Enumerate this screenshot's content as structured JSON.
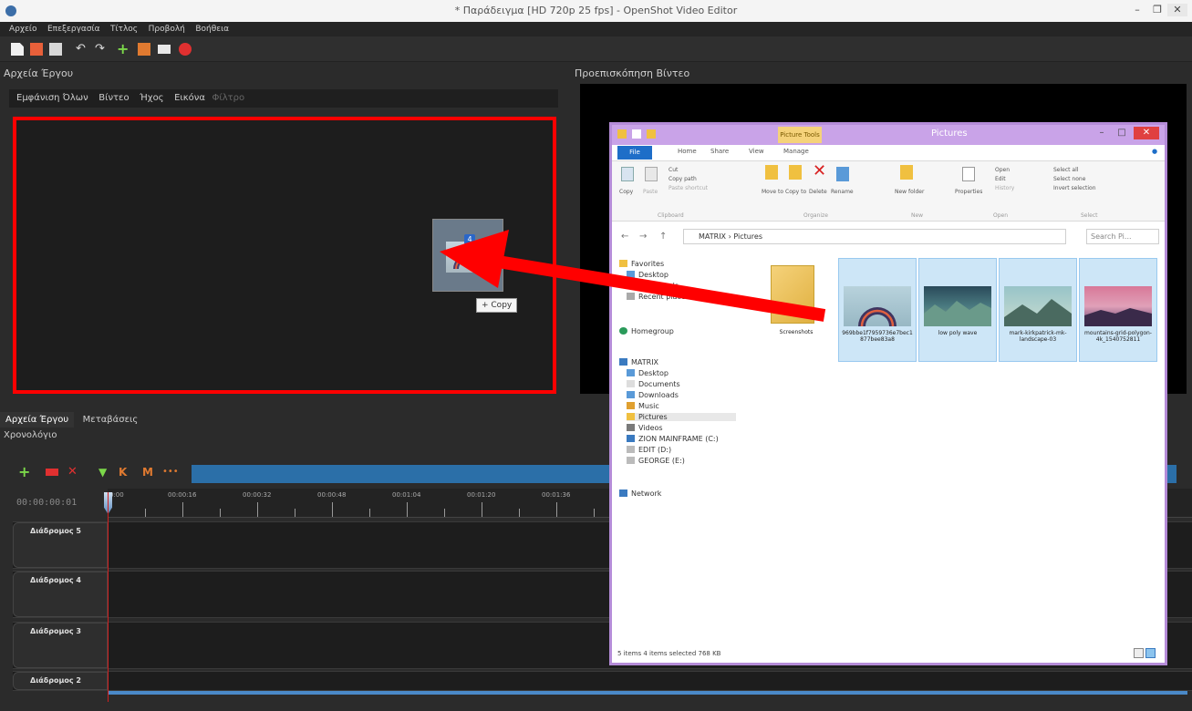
{
  "window": {
    "title": "* Παράδειγμα [HD 720p 25 fps] - OpenShot Video Editor",
    "controls": {
      "minimize": "–",
      "restore": "❐",
      "close": "✕"
    }
  },
  "menu": [
    "Αρχείο",
    "Επεξεργασία",
    "Τίτλος",
    "Προβολή",
    "Βοήθεια"
  ],
  "toolbar_icons": [
    "new-project-icon",
    "open-project-icon",
    "save-project-icon",
    "undo-icon",
    "redo-icon",
    "import-files-icon",
    "profile-icon",
    "fullscreen-icon",
    "export-video-icon"
  ],
  "files_panel": {
    "title": "Αρχεία Έργου",
    "filters": [
      "Εμφάνιση Όλων",
      "Βίντεο",
      "Ήχος",
      "Εικόνα"
    ],
    "filter_placeholder": "Φίλτρο",
    "drag_label": "+ Copy"
  },
  "preview_panel": {
    "title": "Προεπισκόπηση Βίντεο"
  },
  "bottom_tabs": [
    "Αρχεία Έργου",
    "Μεταβάσεις"
  ],
  "timeline": {
    "label": "Χρονολόγιο",
    "time_readout": "00:00:00:01",
    "ticks": [
      "0:00",
      "00:00:16",
      "00:00:32",
      "00:00:48",
      "00:01:04",
      "00:01:20",
      "00:01:36"
    ],
    "tracks": [
      "Διάδρομος 5",
      "Διάδρομος 4",
      "Διάδρομος 3",
      "Διάδρομος 2"
    ]
  },
  "explorer": {
    "title": "Pictures",
    "context_tab": "Picture Tools",
    "controls": {
      "minimize": "–",
      "maximize": "□",
      "close": "✕"
    },
    "tabs": [
      "File",
      "Home",
      "Share",
      "View",
      "Manage"
    ],
    "ribbon": {
      "clipboard": {
        "copy": "Copy",
        "paste": "Paste",
        "cut": "Cut",
        "copy_path": "Copy path",
        "paste_shortcut": "Paste shortcut",
        "group": "Clipboard"
      },
      "organize": {
        "move_to": "Move to",
        "copy_to": "Copy to",
        "delete": "Delete",
        "rename": "Rename",
        "group": "Organize"
      },
      "new": {
        "new_folder": "New folder",
        "group": "New"
      },
      "open": {
        "properties": "Properties",
        "open": "Open",
        "edit": "Edit",
        "history": "History",
        "group": "Open"
      },
      "select": {
        "select_all": "Select all",
        "select_none": "Select none",
        "invert": "Invert selection",
        "group": "Select"
      }
    },
    "address": {
      "nav": [
        "←",
        "→",
        "↑"
      ],
      "path": "MATRIX › Pictures",
      "search_placeholder": "Search Pi..."
    },
    "nav": {
      "favorites": [
        "Favorites",
        "Desktop",
        "Downloads",
        "Recent places"
      ],
      "homegroup": "Homegroup",
      "computer": [
        "MATRIX",
        "Desktop",
        "Documents",
        "Downloads",
        "Music",
        "Pictures",
        "Videos",
        "ZION MAINFRAME (C:)",
        "EDIT (D:)",
        "GEORGE (E:)"
      ],
      "network": "Network"
    },
    "files": [
      {
        "name": "Screenshots",
        "selected": false,
        "kind": "folder"
      },
      {
        "name": "969bbe1f7959736e7bec1877bee83a8",
        "selected": true,
        "kind": "rainbow"
      },
      {
        "name": "low poly wave",
        "selected": true,
        "kind": "wave"
      },
      {
        "name": "mark-kirkpatrick-mk-landscape-03",
        "selected": true,
        "kind": "landscape"
      },
      {
        "name": "mountains-grid-polygon-4k_1540752811",
        "selected": true,
        "kind": "mountains"
      }
    ],
    "status": "5 items    4 items selected  768 KB"
  },
  "colors": {
    "highlight_border": "#ff0000",
    "arrow": "#ff0000",
    "explorer_frame": "#b58cd8",
    "timeline_blue": "#2b6fa8"
  }
}
